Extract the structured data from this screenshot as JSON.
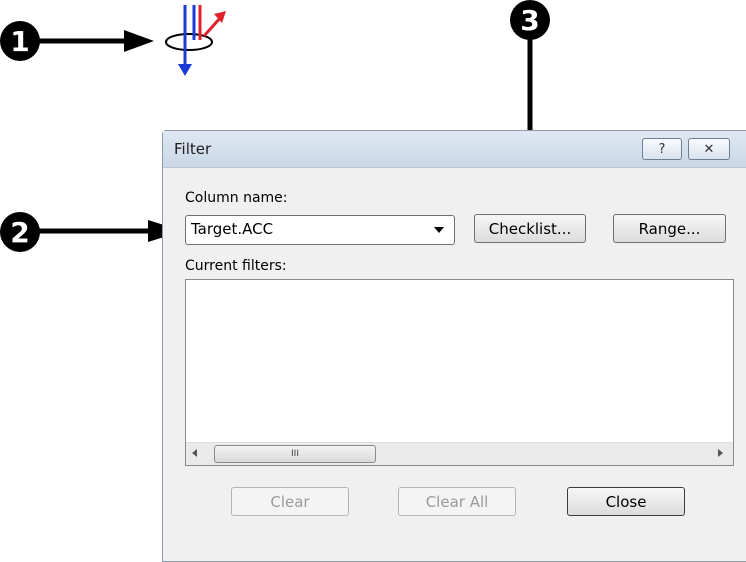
{
  "callouts": {
    "one": "1",
    "two": "2",
    "three": "3"
  },
  "toolbar_icon": {
    "name": "filter-icon",
    "colors": {
      "down_arrow": "#1a3bd6",
      "red_arrow": "#e0202a"
    }
  },
  "dialog": {
    "title": "Filter",
    "help_button": "?",
    "close_icon": "✕",
    "column_name_label": "Column name:",
    "column_select": {
      "value": "Target.ACC"
    },
    "checklist_button": "Checklist...",
    "range_button": "Range...",
    "current_filters_label": "Current filters:",
    "scroll_thumb_grip": "III",
    "clear_button": "Clear",
    "clear_all_button": "Clear All",
    "close_button": "Close"
  }
}
